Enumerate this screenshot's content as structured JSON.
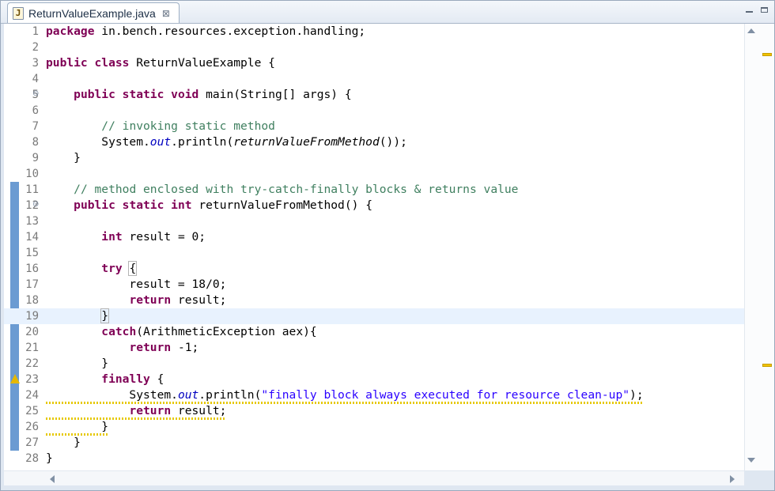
{
  "tab": {
    "title": "ReturnValueExample.java",
    "close_glyph": "⊠",
    "icon": "java-file-icon"
  },
  "editor": {
    "lines": [
      [
        [
          "kw",
          "package"
        ],
        [
          "",
          " in.bench.resources.exception.handling;"
        ]
      ],
      [],
      [
        [
          "kw",
          "public"
        ],
        [
          "",
          ""
        ],
        [
          "kw",
          " class"
        ],
        [
          "",
          " ReturnValueExample {"
        ]
      ],
      [],
      [
        [
          "",
          "    "
        ],
        [
          "kw",
          "public"
        ],
        [
          "kw",
          " static"
        ],
        [
          "kw",
          " void"
        ],
        [
          "",
          " main(String[] args) {"
        ]
      ],
      [],
      [
        [
          "",
          "        "
        ],
        [
          "cm",
          "// invoking static method"
        ]
      ],
      [
        [
          "",
          "        System."
        ],
        [
          "fi",
          "out"
        ],
        [
          "",
          ".println("
        ],
        [
          "it",
          "returnValueFromMethod"
        ],
        [
          "",
          "());"
        ]
      ],
      [
        [
          "",
          "    }"
        ]
      ],
      [],
      [
        [
          "",
          "    "
        ],
        [
          "cm",
          "// method enclosed with try-catch-finally blocks & returns value"
        ]
      ],
      [
        [
          "",
          "    "
        ],
        [
          "kw",
          "public"
        ],
        [
          "kw",
          " static"
        ],
        [
          "kw",
          " int"
        ],
        [
          "",
          " returnValueFromMethod() {"
        ]
      ],
      [],
      [
        [
          "",
          "        "
        ],
        [
          "kw",
          "int"
        ],
        [
          "",
          " result = 0;"
        ]
      ],
      [],
      [
        [
          "",
          "        "
        ],
        [
          "kw",
          "try"
        ],
        [
          "",
          " "
        ],
        [
          "br",
          "{"
        ]
      ],
      [
        [
          "",
          "            result = 18/0;"
        ]
      ],
      [
        [
          "",
          "            "
        ],
        [
          "kw",
          "return"
        ],
        [
          "",
          " result;"
        ]
      ],
      [
        [
          "",
          "        "
        ],
        [
          "br",
          "}"
        ]
      ],
      [
        [
          "",
          "        "
        ],
        [
          "kw",
          "catch"
        ],
        [
          "",
          "(ArithmeticException aex){"
        ]
      ],
      [
        [
          "",
          "            "
        ],
        [
          "kw",
          "return"
        ],
        [
          "",
          " -1;"
        ]
      ],
      [
        [
          "",
          "        }"
        ]
      ],
      [
        [
          "",
          "        "
        ],
        [
          "kw",
          "finally"
        ],
        [
          "",
          " {"
        ]
      ],
      [
        [
          "",
          "            System."
        ],
        [
          "fi",
          "out"
        ],
        [
          "",
          ".println("
        ],
        [
          "st",
          "\"finally block always executed for resource clean-up\""
        ],
        [
          "",
          ");"
        ]
      ],
      [
        [
          "",
          "            "
        ],
        [
          "kw",
          "return"
        ],
        [
          "",
          " result;"
        ]
      ],
      [
        [
          "",
          "        }"
        ]
      ],
      [
        [
          "",
          "    }"
        ]
      ],
      [
        [
          "",
          "}"
        ]
      ]
    ],
    "fold_lines": [
      5,
      12
    ],
    "warning_line": 23,
    "current_line": 19,
    "changed_ranges": [
      [
        11,
        27
      ]
    ],
    "warning_underline_lines": [
      24,
      25,
      26
    ],
    "colors": {
      "keyword": "#7f0055",
      "comment": "#3f7f5f",
      "string": "#2a00ff",
      "field": "#0000c0",
      "current_line": "#e8f2fe",
      "change_marker": "#6b9bd2",
      "warning": "#e6b800"
    }
  }
}
